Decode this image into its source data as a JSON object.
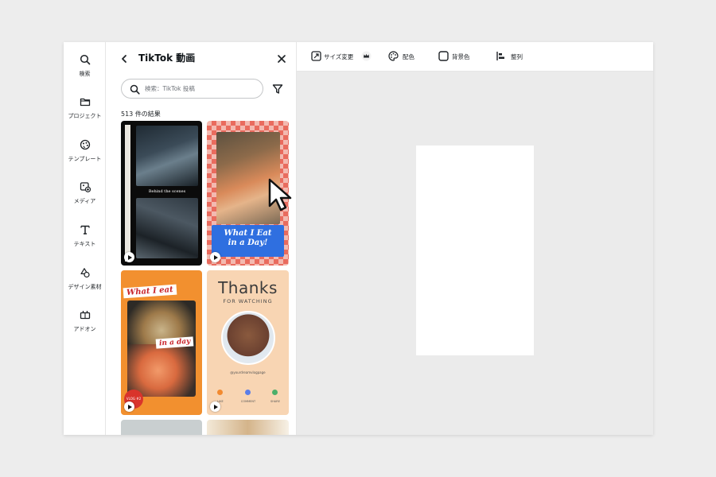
{
  "sidebar": {
    "items": [
      {
        "label": "検索",
        "icon": "search-icon"
      },
      {
        "label": "プロジェクト",
        "icon": "folder-icon"
      },
      {
        "label": "テンプレート",
        "icon": "template-icon"
      },
      {
        "label": "メディア",
        "icon": "media-icon"
      },
      {
        "label": "テキスト",
        "icon": "text-icon"
      },
      {
        "label": "デザイン素材",
        "icon": "shapes-icon"
      },
      {
        "label": "アドオン",
        "icon": "addon-icon"
      }
    ]
  },
  "panel": {
    "title": "TikTok 動画",
    "search": {
      "placeholder": "検索：TikTok 投稿",
      "value": ""
    },
    "result_count": "513 件の結果",
    "templates": [
      {
        "caption": "Behind the scenes"
      },
      {
        "line1": "What I Eat",
        "line2": "in a Day!"
      },
      {
        "line1": "What I eat",
        "line2": "in a day",
        "badge": "VLOG #2"
      },
      {
        "title": "Thanks",
        "subtitle": "FOR WATCHING",
        "handle": "@yourdreamvlogpage",
        "actions": [
          "LIKE",
          "COMMENT",
          "SHARE"
        ]
      }
    ]
  },
  "toolbar": {
    "items": [
      {
        "label": "サイズ変更",
        "icon": "resize-icon"
      },
      {
        "label": "配色",
        "icon": "palette-icon"
      },
      {
        "label": "背景色",
        "icon": "background-color-icon"
      },
      {
        "label": "整列",
        "icon": "align-icon"
      }
    ]
  },
  "colors": {
    "accent_blue": "#2f6fe0",
    "dot_orange": "#f28a30",
    "dot_blue": "#5b7ee8",
    "dot_green": "#4caf6a"
  }
}
